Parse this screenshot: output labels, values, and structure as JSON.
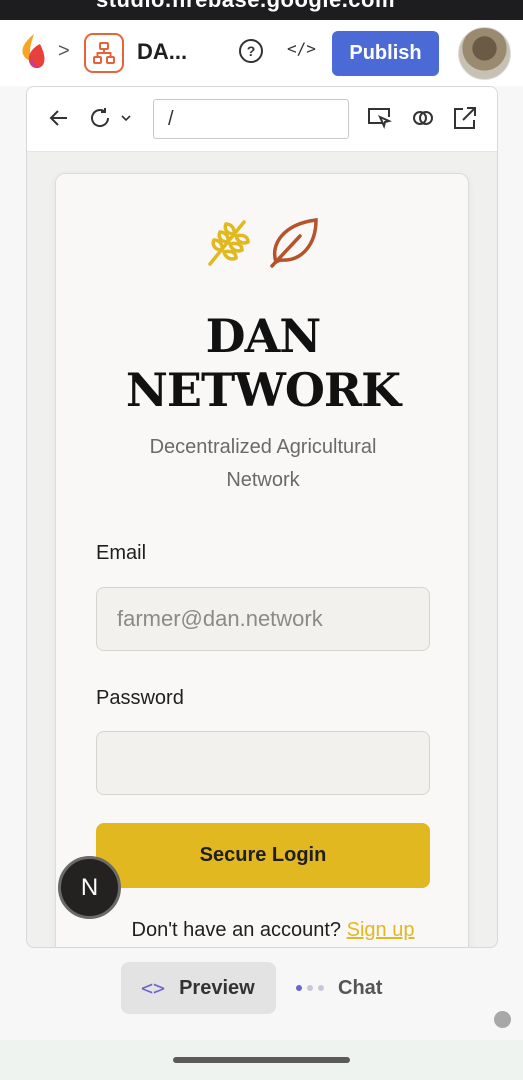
{
  "status_bar": {
    "url": "studio.firebase.google.com"
  },
  "app_bar": {
    "project_name": "DA...",
    "help_symbol": "?",
    "code_symbol": "</>",
    "publish_label": "Publish"
  },
  "preview_toolbar": {
    "url_value": "/"
  },
  "login_card": {
    "title_line1": "DAN",
    "title_line2": "NETWORK",
    "subtitle": "Decentralized Agricultural Network",
    "email_label": "Email",
    "email_placeholder": "farmer@dan.network",
    "password_label": "Password",
    "password_placeholder": "",
    "login_button": "Secure Login",
    "signup_prompt": "Don't have an account?",
    "signup_link": "Sign up"
  },
  "dev_badge": {
    "letter": "N"
  },
  "bottom_tabs": {
    "preview_label": "Preview",
    "chat_label": "Chat"
  },
  "colors": {
    "publish": "#4b6ad6",
    "accent_gold": "#e1b81f",
    "leaf": "#b5532a",
    "tab_icon": "#6b63d0"
  },
  "icons": [
    "firebase-studio-logo",
    "chevron-right-icon",
    "project-structure-icon",
    "help-icon",
    "code-icon",
    "back-arrow-icon",
    "reload-icon",
    "select-element-icon",
    "link-icon",
    "open-external-icon",
    "wheat-icon",
    "leaf-icon"
  ]
}
